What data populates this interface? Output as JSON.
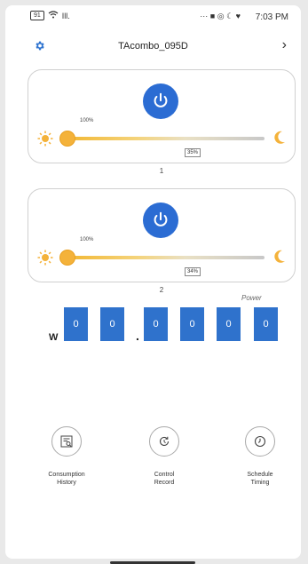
{
  "status_bar": {
    "time": "7:03 PM",
    "battery": "91",
    "signal_text": "Ill.",
    "middle_icons": "··· ■ ◎ ☾ ♥"
  },
  "header": {
    "title": "TAcombo_095D"
  },
  "channels": [
    {
      "label": "1",
      "brightness_top": "100%",
      "brightness_value": "35%",
      "level": 0.35
    },
    {
      "label": "2",
      "brightness_top": "100%",
      "brightness_value": "34%",
      "level": 0.34
    }
  ],
  "power": {
    "label": "Power",
    "digits": [
      "0",
      "0",
      "0",
      "0",
      "0",
      "0"
    ],
    "unit": "W",
    "decimal_point": "."
  },
  "actions": {
    "consumption_line1": "Consumption",
    "consumption_line2": "History",
    "control_line1": "Control",
    "control_line2": "Record",
    "schedule_line1": "Schedule",
    "schedule_line2": "Timing"
  },
  "icons": {
    "settings": "gear-icon",
    "back": "chevron-icon",
    "power": "power-icon",
    "sun": "sun-icon",
    "moon": "moon-icon",
    "history": "consumption-history-icon",
    "record": "refresh-icon",
    "timer": "clock-icon"
  },
  "colors": {
    "accent": "#2b6cd3",
    "slider_warm": "#f4b23a",
    "digit_bg": "#2f72cc"
  }
}
